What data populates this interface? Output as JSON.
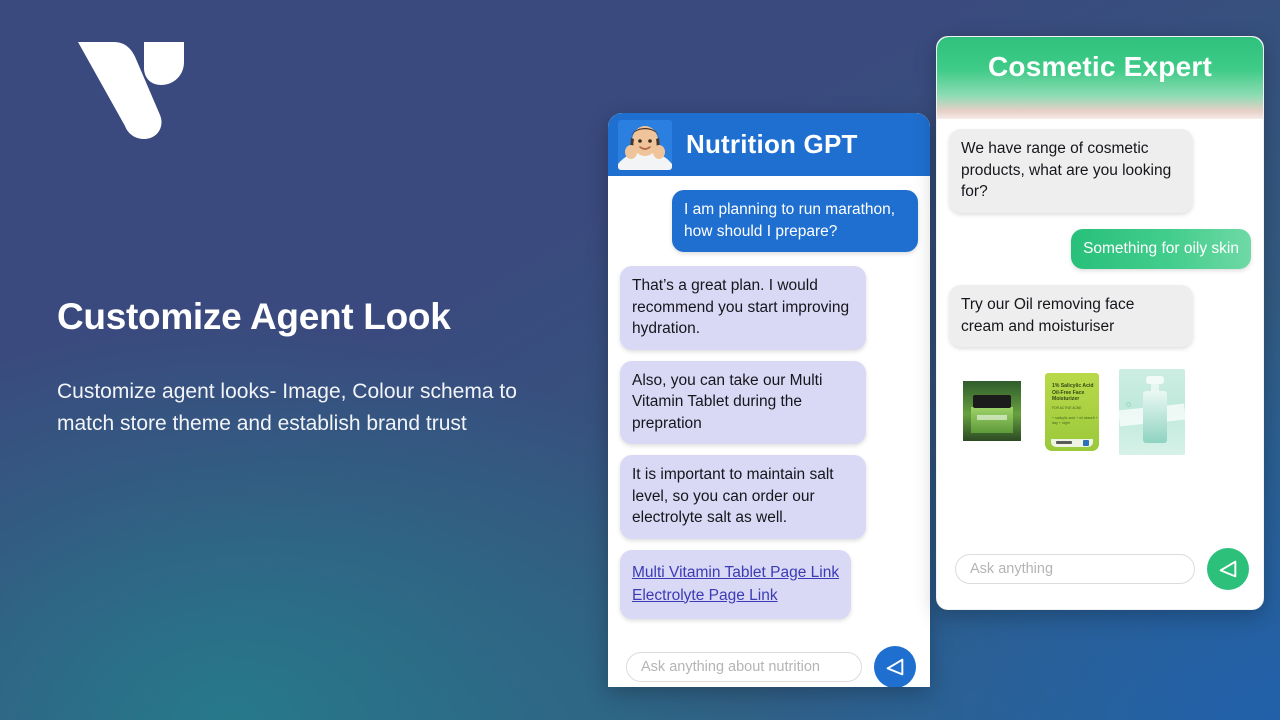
{
  "brand": {
    "logo_name": "v-logo"
  },
  "hero": {
    "headline": "Customize Agent Look",
    "subcopy": "Customize agent looks- Image, Colour schema to match store theme and establish brand trust"
  },
  "nutrition_panel": {
    "title": "Nutrition GPT",
    "avatar_name": "nutritionist-avatar",
    "accent_color": "#1f6fd0",
    "bot_bubble_color": "#d9d8f5",
    "messages": [
      {
        "role": "user",
        "text": "I am planning to run marathon, how should I prepare?"
      },
      {
        "role": "bot",
        "text": "That’s a great plan. I would recommend you start improving  hydration."
      },
      {
        "role": "bot",
        "text": "Also, you can take our Multi Vitamin Tablet during the prepration"
      },
      {
        "role": "bot",
        "text": "It is important to maintain salt level, so you can order our electrolyte salt as well."
      }
    ],
    "links": [
      {
        "label": "Multi Vitamin Tablet Page Link"
      },
      {
        "label": "Electrolyte Page Link"
      }
    ],
    "input": {
      "value": "",
      "placeholder": "Ask anything about nutrition"
    },
    "send_button": {
      "icon": "send-triangle-icon",
      "label": "Send"
    }
  },
  "cosmetic_panel": {
    "title": "Cosmetic Expert",
    "accent_color": "#2dc07a",
    "bot_bubble_color": "#eeeeee",
    "messages": [
      {
        "role": "bot",
        "text": "We have range of cosmetic products, what are you looking for?"
      },
      {
        "role": "user",
        "text": "Something for oily skin"
      },
      {
        "role": "bot",
        "text": "Try our Oil removing face cream and moisturiser"
      }
    ],
    "products": [
      {
        "name": "green-cream-jar",
        "alt": "Green cosmetic cream jar"
      },
      {
        "name": "salicylic-acid-moisturizer-tube",
        "alt": "1% Salicylic Acid Oil-Free Face Moisturizer tube",
        "label_title": "1% Salicylic Acid Oil-Free Face Moisturizer",
        "label_sub": "FOR ACTIVE ACNE",
        "label_bullets": "+ salicylic acid\n+ oil absorb\n+ day + night"
      },
      {
        "name": "teal-pump-bottle",
        "alt": "Teal pump bottle moisturiser"
      }
    ],
    "input": {
      "value": "",
      "placeholder": "Ask anything"
    },
    "send_button": {
      "icon": "send-triangle-icon",
      "label": "Send"
    }
  }
}
